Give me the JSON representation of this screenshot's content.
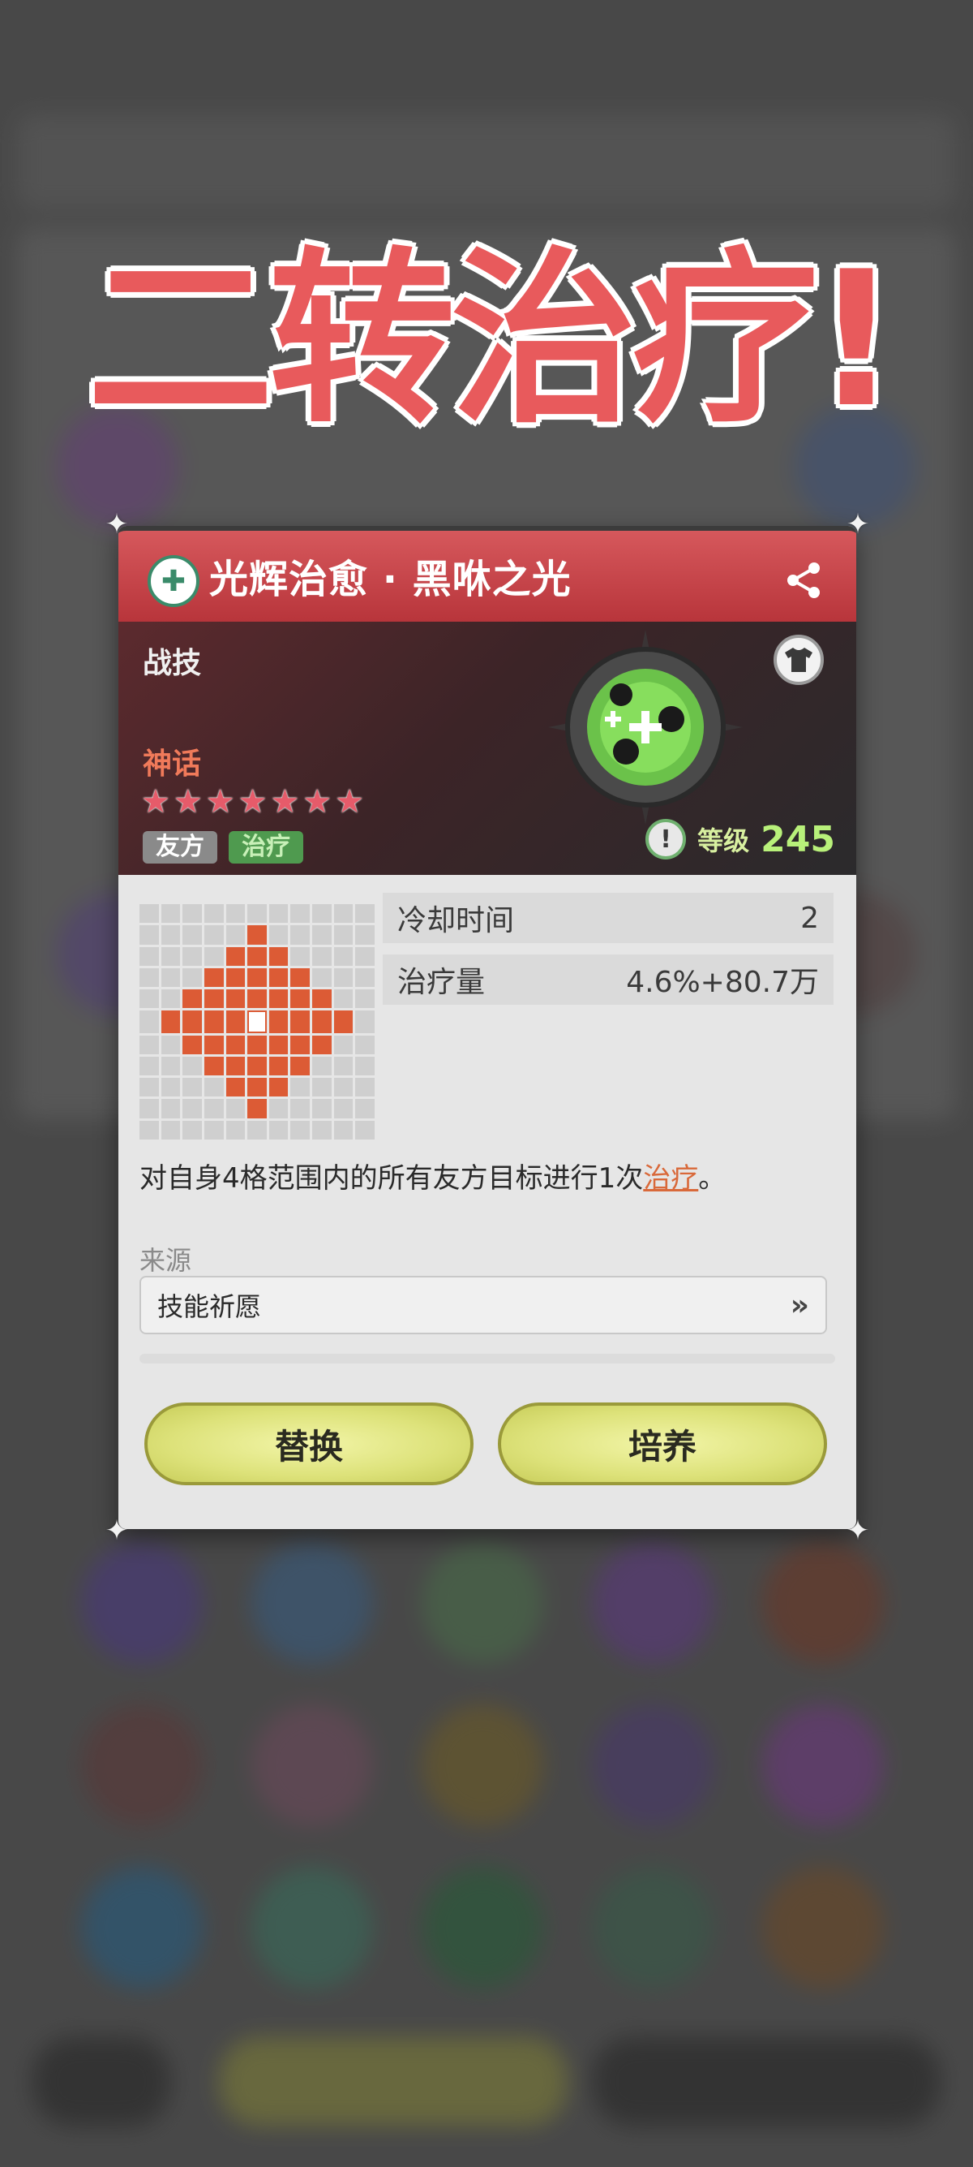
{
  "headline": "二转治疗!",
  "skill": {
    "name": "光辉治愈 · 黑咻之光",
    "type": "战技",
    "rarity": "神话",
    "stars": 7,
    "tags": [
      "友方",
      "治疗"
    ],
    "level_label": "等级",
    "level": "245",
    "warning_mark": "!"
  },
  "stats": {
    "cooldown_label": "冷却时间",
    "cooldown_value": "2",
    "heal_label": "治疗量",
    "heal_value": "4.6%+80.7万"
  },
  "description": {
    "prefix": "对自身4格范围内的所有友方目标进行1次",
    "link": "治疗",
    "suffix": "。"
  },
  "source": {
    "label": "来源",
    "item": "技能祈愿"
  },
  "buttons": {
    "replace": "替换",
    "cultivate": "培养"
  },
  "colors": {
    "headline": "#e85a5c",
    "title_bar": "#c6474c",
    "range_cell": "#dc5b35",
    "button": "#dde27a"
  }
}
